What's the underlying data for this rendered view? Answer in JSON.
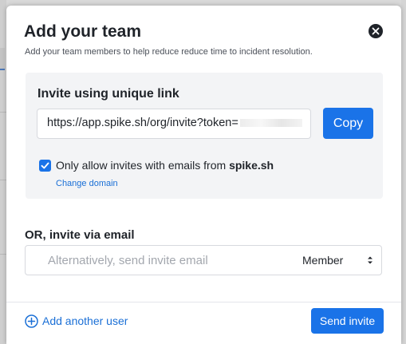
{
  "modal": {
    "title": "Add your team",
    "subtitle": "Add your team members to help reduce reduce time to incident resolution."
  },
  "invite_link": {
    "heading": "Invite using unique link",
    "url_value": "https://app.spike.sh/org/invite?token=",
    "copy_label": "Copy",
    "restrict_checked": true,
    "restrict_label_prefix": "Only allow invites with emails from ",
    "restrict_domain": "spike.sh",
    "change_domain_label": "Change domain"
  },
  "email_invite": {
    "heading": "OR, invite via email",
    "placeholder": "Alternatively, send invite email",
    "value": "",
    "role_selected": "Member"
  },
  "footer": {
    "add_user_label": "Add another user",
    "send_label": "Send invite"
  },
  "colors": {
    "accent": "#1a73e8",
    "link": "#1a6fd6",
    "panel_bg": "#f3f4f6"
  },
  "icons": {
    "close": "close-icon",
    "checkbox": "checkmark-icon",
    "add_user": "plus-circle-icon",
    "select": "chevron-updown-icon"
  }
}
